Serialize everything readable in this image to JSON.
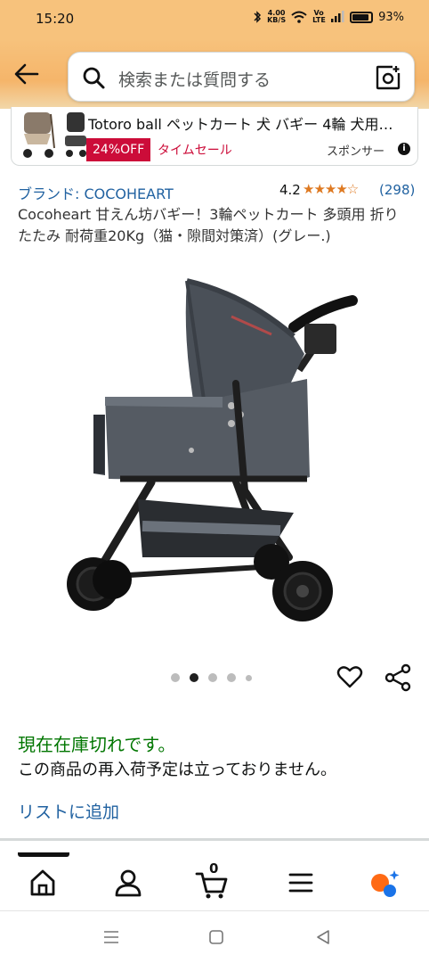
{
  "status_bar": {
    "time": "15:20",
    "net_speed_value": "4.00",
    "net_speed_unit": "KB/S",
    "volte": "Vo LTE",
    "battery": "93%"
  },
  "search": {
    "placeholder": "検索または質問する"
  },
  "sponsored_ad": {
    "title": "Totoro ball ペットカート 犬 バギー 4輪 犬用…",
    "badge": "24%OFF",
    "deal_label": "タイムセール",
    "sponsor_label": "スポンサー",
    "info_glyph": "i"
  },
  "product": {
    "brand": "ブランド: COCOHEART",
    "rating": "4.2",
    "stars": "★★★★☆",
    "review_count": "(298)",
    "title": "Cocoheart 甘えん坊バギー！3輪ペットカート 多頭用 折りたたみ 耐荷重20Kg（猫・隙間対策済）(グレー.)",
    "image_icon": "pet-stroller-image",
    "gallery": {
      "total": 5,
      "active_index": 1
    }
  },
  "availability": {
    "status": "現在在庫切れです。",
    "note": "この商品の再入荷予定は立っておりません。",
    "add_to_list": "リストに追加"
  },
  "bottom_nav": {
    "items": [
      "home-icon",
      "account-icon",
      "cart-icon",
      "menu-icon",
      "rufus-icon"
    ],
    "cart_count": "0"
  },
  "colors": {
    "header": "#f7c27c",
    "link": "#2162a1",
    "in_stock_green": "#007600",
    "deal_red": "#cc0c39",
    "star": "#de7921"
  }
}
